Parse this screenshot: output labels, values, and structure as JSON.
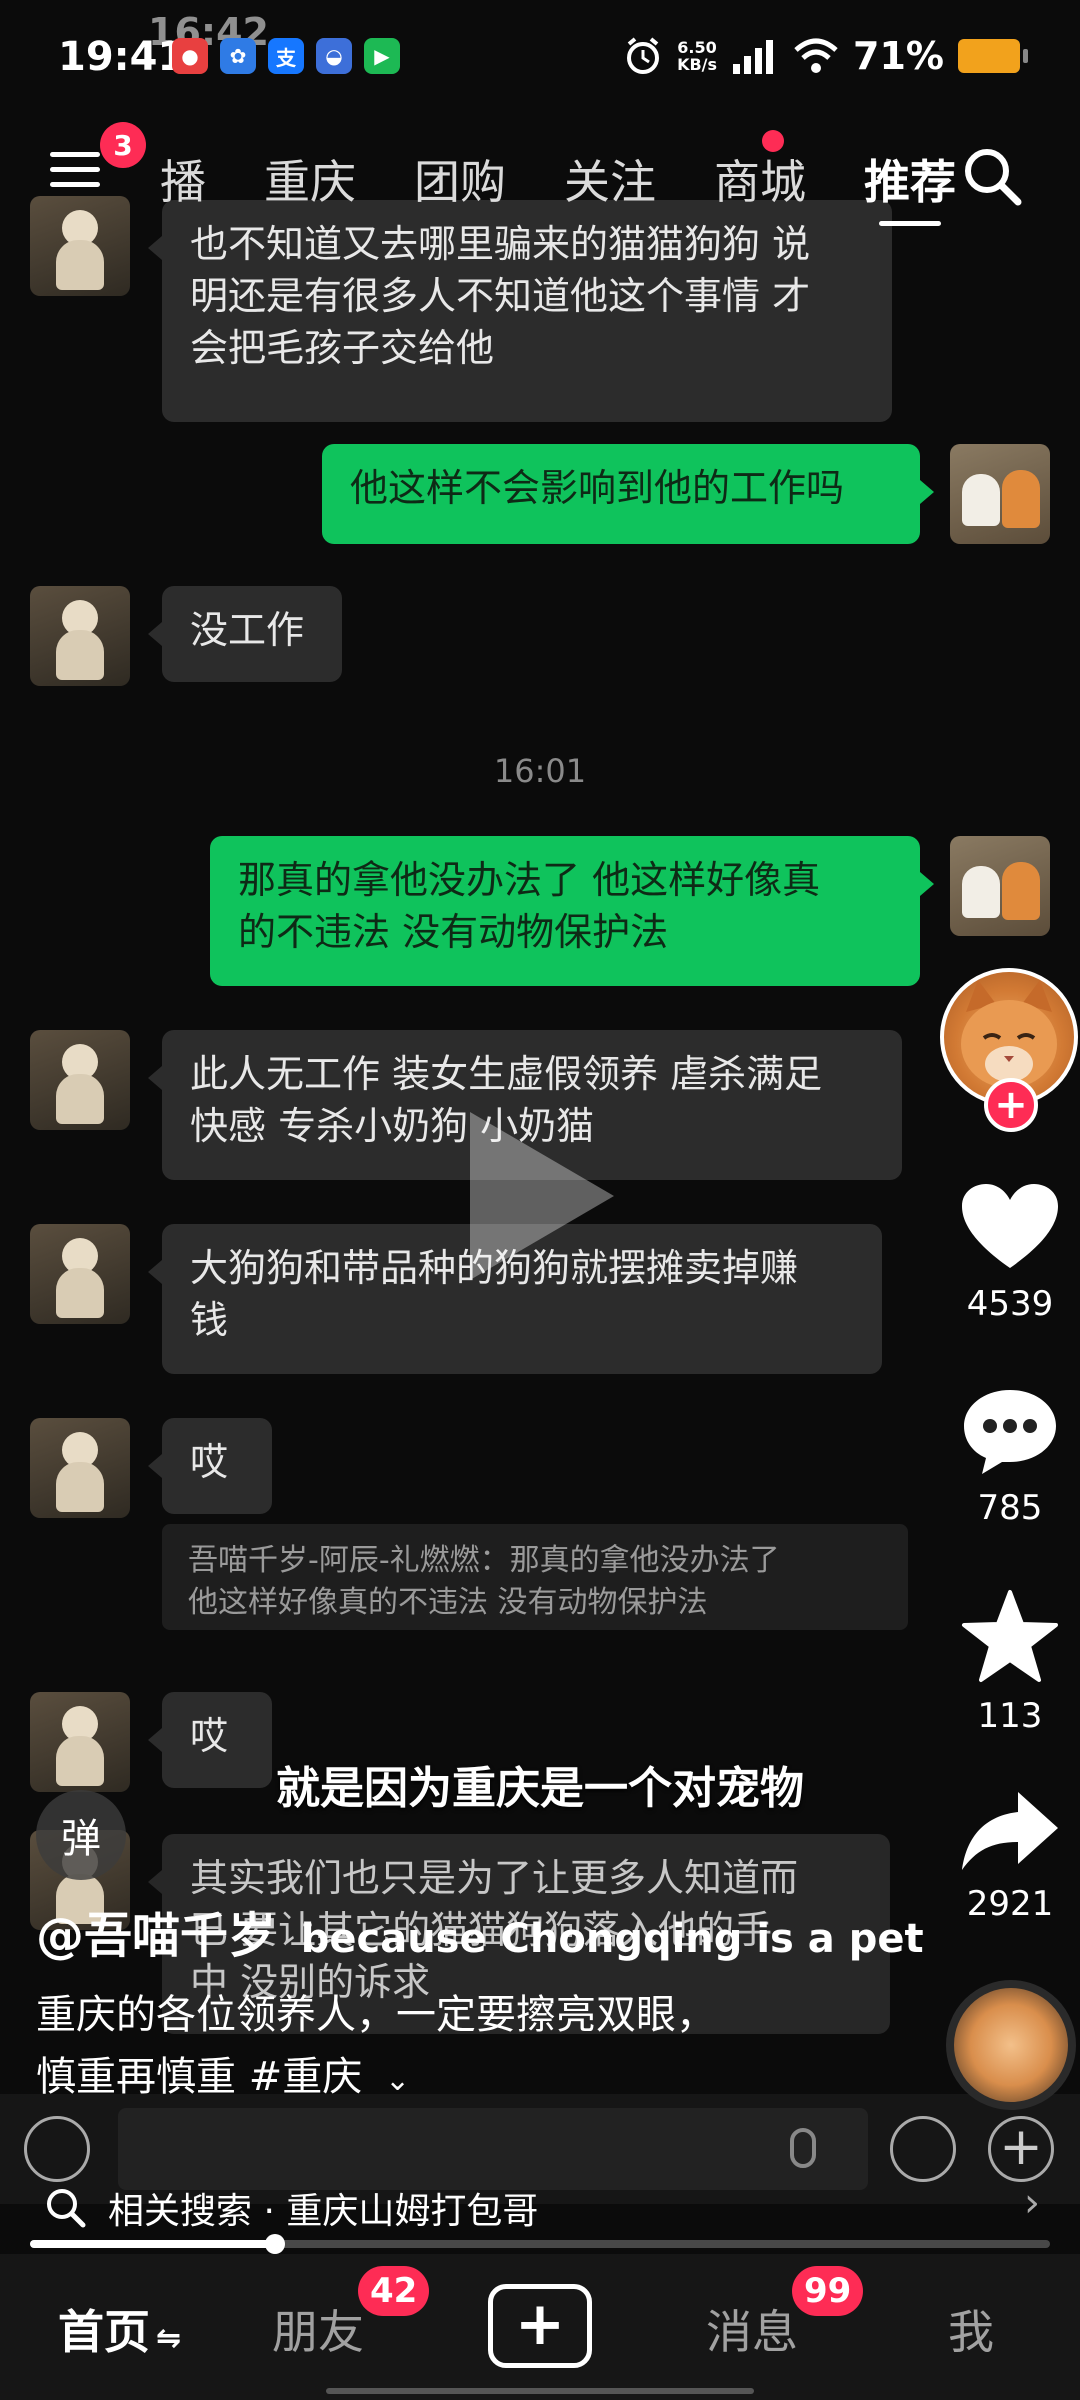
{
  "status_bar": {
    "time": "19:41",
    "overlay_time": "16:42",
    "network_speed": "6.50",
    "network_unit": "KB/s",
    "signal": "6G",
    "battery": "71%"
  },
  "top_nav": {
    "menu_badge": "3",
    "tabs": [
      {
        "label": "播"
      },
      {
        "label": "重庆"
      },
      {
        "label": "团购"
      },
      {
        "label": "关注"
      },
      {
        "label": "商城"
      },
      {
        "label": "推荐"
      }
    ],
    "active_tab": "推荐"
  },
  "chat": {
    "messages": [
      {
        "side": "in",
        "lines": [
          "也不知道又去哪里骗来的猫猫狗狗 说",
          "明还是有很多人不知道他这个事情 才",
          "会把毛孩子交给他"
        ]
      },
      {
        "side": "out",
        "lines": [
          "他这样不会影响到他的工作吗"
        ]
      },
      {
        "side": "in",
        "lines": [
          "没工作"
        ]
      },
      {
        "side": "out",
        "lines": [
          "那真的拿他没办法了   他这样好像真",
          "的不违法  没有动物保护法"
        ]
      },
      {
        "side": "in",
        "lines": [
          "此人无工作 装女生虚假领养 虐杀满足",
          "快感 专杀小奶狗 小奶猫"
        ]
      },
      {
        "side": "in",
        "lines": [
          "大狗狗和带品种的狗狗就摆摊卖掉赚",
          "钱"
        ]
      },
      {
        "side": "in",
        "lines": [
          "哎"
        ]
      },
      {
        "side": "in",
        "lines": [
          "哎"
        ]
      },
      {
        "side": "in",
        "lines": [
          "其实我们也只是为了让更多人知道而",
          "已 要让其它的猫猫狗狗落入他的手",
          "中 没别的诉求"
        ]
      }
    ],
    "timestamp": "16:01",
    "quote": [
      "吾喵千岁-阿辰-礼燃燃：那真的拿他没办法了",
      "他这样好像真的不违法  没有动物保护法"
    ]
  },
  "actions": {
    "likes": "4539",
    "comments": "785",
    "favorites": "113",
    "shares": "2921"
  },
  "caption": {
    "subtitle_cn": "就是因为重庆是一个对宠物",
    "subtitle_en": "because Chongqing is a pet",
    "danmu_label": "弹",
    "author": "@吾喵千岁",
    "desc_line1": "重庆的各位领养人，一定要擦亮双眼，",
    "desc_line2": "慎重再慎重 #重庆"
  },
  "related_search": {
    "prefix": "相关搜索",
    "separator": "·",
    "query": "重庆山姆打包哥"
  },
  "progress": {
    "fraction": 0.24
  },
  "bottom_nav": {
    "home": "首页",
    "home_icon": "⇋",
    "friends": "朋友",
    "friends_badge": "42",
    "add": "+",
    "messages": "消息",
    "messages_badge": "99",
    "me": "我"
  },
  "colors": {
    "accent": "#fe2c55",
    "outgoing_bubble": "#0fc35c",
    "incoming_bubble": "#2c2c2c"
  }
}
